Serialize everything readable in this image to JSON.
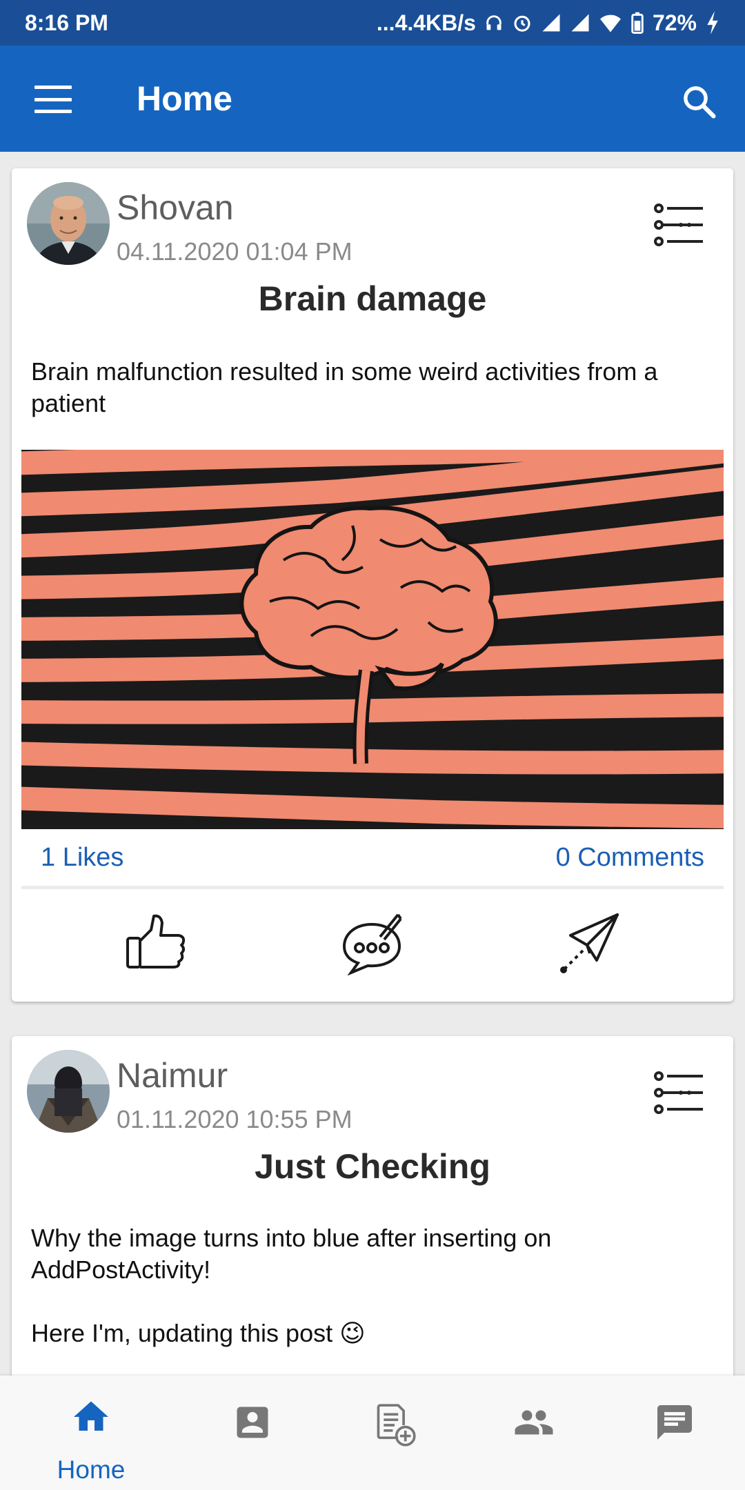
{
  "status_bar": {
    "time": "8:16 PM",
    "indicators": "...4.4KB/s",
    "battery": "72%"
  },
  "app_bar": {
    "title": "Home",
    "menu_icon": "hamburger-menu-icon",
    "search_icon": "search-icon"
  },
  "posts": [
    {
      "author": "Shovan",
      "time": "04.11.2020 01:04 PM",
      "title": "Brain damage",
      "body": "Brain malfunction resulted in some weird activities from a patient",
      "likes": "1 Likes",
      "comments": "0 Comments"
    },
    {
      "author": "Naimur",
      "time": "01.11.2020 10:55 PM",
      "title": "Just Checking",
      "body": "Why the image turns into blue after inserting on AddPostActivity!\n\nHere I'm, updating this post 😉"
    }
  ],
  "bottom_nav": {
    "home_label": "Home",
    "active": "home"
  },
  "colors": {
    "primary": "#1565c0",
    "status_bar": "#1a4f97",
    "link": "#1a5fb4",
    "image_salmon": "#f08a70"
  }
}
